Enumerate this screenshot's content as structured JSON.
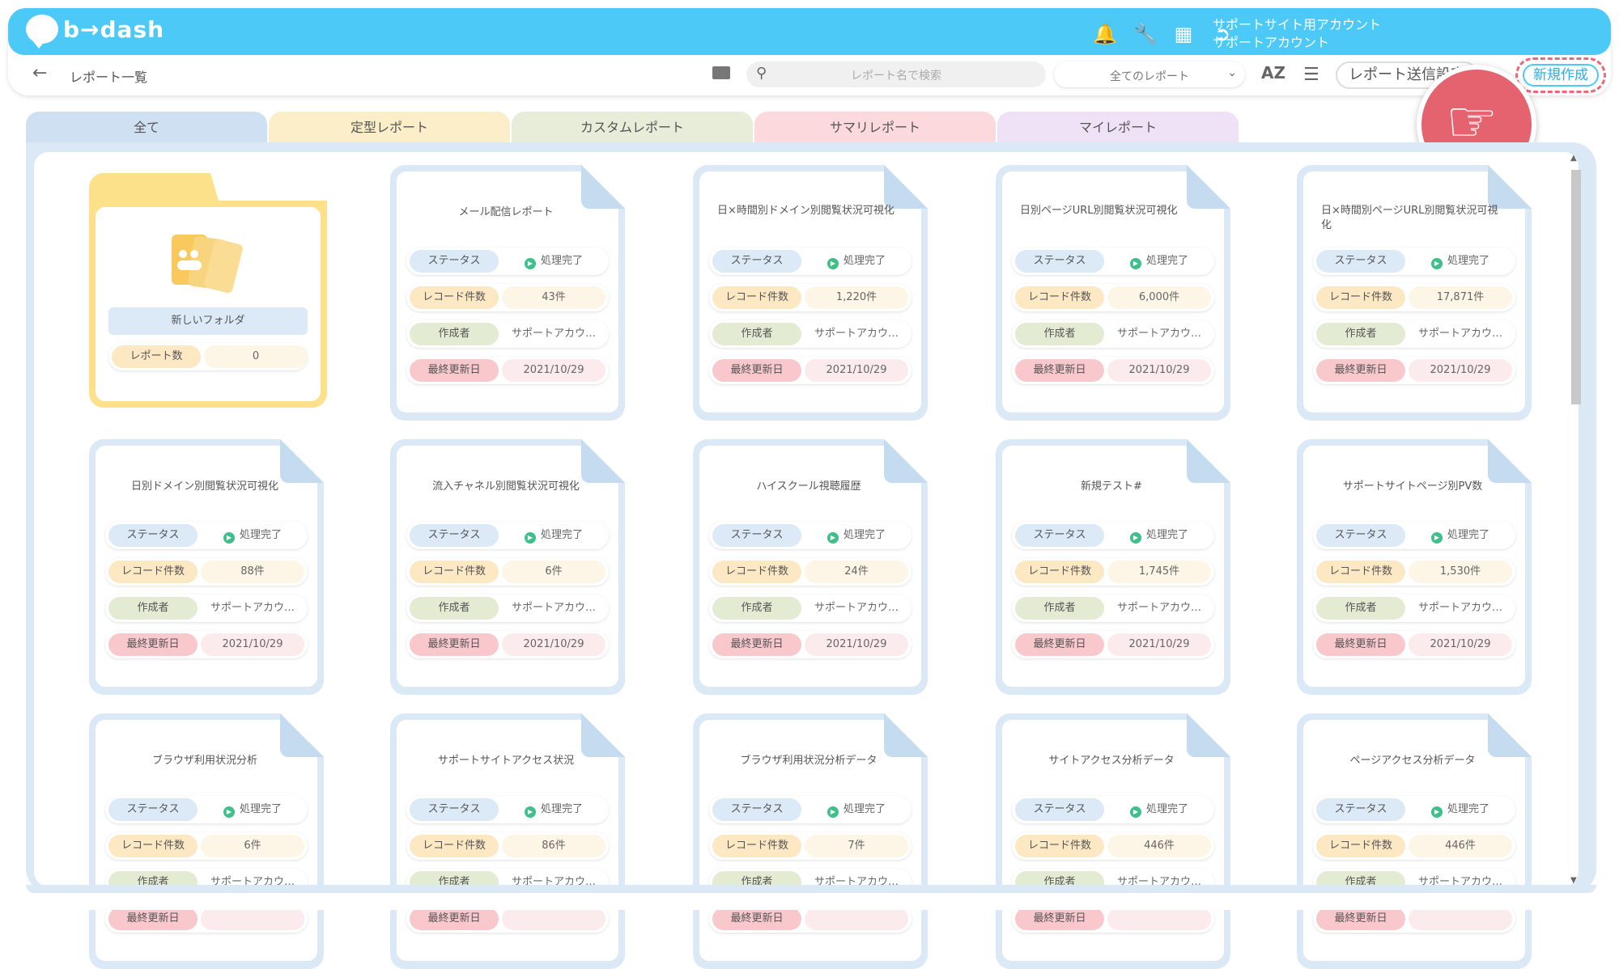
{
  "app": {
    "logo_text": "b→dash"
  },
  "account": {
    "line1": "サポートサイト用アカウント",
    "line2": "サポートアカウント"
  },
  "icons": {
    "bell": "bell-icon",
    "settings": "wrench-icon",
    "apps": "grid-icon",
    "logout": "logout-icon"
  },
  "breadcrumb": {
    "back": "←",
    "title": "レポート一覧"
  },
  "toolbar": {
    "search_placeholder": "レポート名で検索",
    "filter_value": "全てのレポート",
    "sort_label": "AZ",
    "send_settings_label": "レポート送信設定",
    "new_label": "新規作成"
  },
  "tabs": [
    {
      "label": "全て",
      "color": "#cfe0f3"
    },
    {
      "label": "定型レポート",
      "color": "#fbeec8"
    },
    {
      "label": "カスタムレポート",
      "color": "#e7edd9"
    },
    {
      "label": "サマリレポート",
      "color": "#fbd9dc"
    },
    {
      "label": "マイレポート",
      "color": "#efe2f7"
    }
  ],
  "labels": {
    "status": "ステータス",
    "record_count": "レコード件数",
    "author": "作成者",
    "updated": "最終更新日",
    "report_count": "レポート数"
  },
  "folder": {
    "name": "新しいフォルダ",
    "report_count": "0"
  },
  "reports": [
    {
      "title": "メール配信レポート",
      "status": "処理完了",
      "count": "43件",
      "author": "サポートアカウ…",
      "date": "2021/10/29"
    },
    {
      "title": "日×時間別ドメイン別閲覧状況可視化",
      "status": "処理完了",
      "count": "1,220件",
      "author": "サポートアカウ…",
      "date": "2021/10/29"
    },
    {
      "title": "日別ページURL別閲覧状況可視化",
      "status": "処理完了",
      "count": "6,000件",
      "author": "サポートアカウ…",
      "date": "2021/10/29"
    },
    {
      "title": "日×時間別ページURL別閲覧状況可視化",
      "status": "処理完了",
      "count": "17,871件",
      "author": "サポートアカウ…",
      "date": "2021/10/29"
    },
    {
      "title": "日別ドメイン別閲覧状況可視化",
      "status": "処理完了",
      "count": "88件",
      "author": "サポートアカウ…",
      "date": "2021/10/29"
    },
    {
      "title": "流入チャネル別閲覧状況可視化",
      "status": "処理完了",
      "count": "6件",
      "author": "サポートアカウ…",
      "date": "2021/10/29"
    },
    {
      "title": "ハイスクール視聴履歴",
      "status": "処理完了",
      "count": "24件",
      "author": "サポートアカウ…",
      "date": "2021/10/29"
    },
    {
      "title": "新規テスト#",
      "status": "処理完了",
      "count": "1,745件",
      "author": "サポートアカウ…",
      "date": "2021/10/29"
    },
    {
      "title": "サポートサイトページ別PV数",
      "status": "処理完了",
      "count": "1,530件",
      "author": "サポートアカウ…",
      "date": "2021/10/29"
    },
    {
      "title": "ブラウザ利用状況分析",
      "status": "処理完了",
      "count": "6件",
      "author": "サポートアカウ…",
      "date": ""
    },
    {
      "title": "サポートサイトアクセス状況",
      "status": "処理完了",
      "count": "86件",
      "author": "サポートアカウ…",
      "date": ""
    },
    {
      "title": "ブラウザ利用状況分析データ",
      "status": "処理完了",
      "count": "7件",
      "author": "サポートアカウ…",
      "date": ""
    },
    {
      "title": "サイトアクセス分析データ",
      "status": "処理完了",
      "count": "446件",
      "author": "サポートアカウ…",
      "date": ""
    },
    {
      "title": "ページアクセス分析データ",
      "status": "処理完了",
      "count": "446件",
      "author": "サポートアカウ…",
      "date": ""
    }
  ]
}
